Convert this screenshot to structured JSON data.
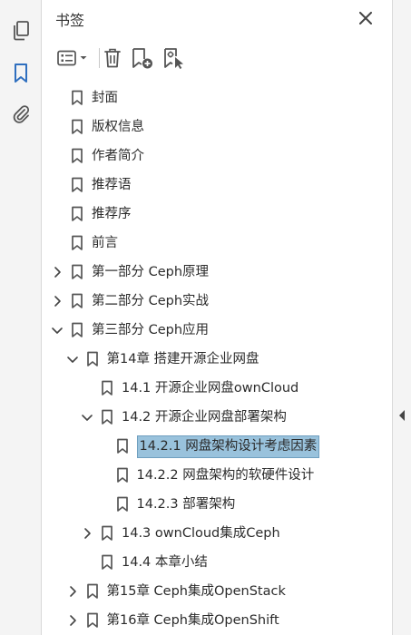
{
  "panel": {
    "title": "书签"
  },
  "left_rail": {
    "items": [
      "pages-icon",
      "bookmark-icon",
      "attachment-icon"
    ],
    "active": "bookmark-icon"
  },
  "toolbar": {
    "buttons": [
      "options-menu",
      "delete-bookmark",
      "new-bookmark",
      "new-bookmark-from-structure"
    ]
  },
  "tree": [
    {
      "label": "封面",
      "level": 0,
      "twisty": "none"
    },
    {
      "label": "版权信息",
      "level": 0,
      "twisty": "none"
    },
    {
      "label": "作者简介",
      "level": 0,
      "twisty": "none"
    },
    {
      "label": "推荐语",
      "level": 0,
      "twisty": "none"
    },
    {
      "label": "推荐序",
      "level": 0,
      "twisty": "none"
    },
    {
      "label": "前言",
      "level": 0,
      "twisty": "none"
    },
    {
      "label": "第一部分 Ceph原理",
      "level": 0,
      "twisty": "collapsed"
    },
    {
      "label": "第二部分 Ceph实战",
      "level": 0,
      "twisty": "collapsed"
    },
    {
      "label": "第三部分 Ceph应用",
      "level": 0,
      "twisty": "expanded"
    },
    {
      "label": "第14章 搭建开源企业网盘",
      "level": 1,
      "twisty": "expanded"
    },
    {
      "label": "14.1 开源企业网盘ownCloud",
      "level": 2,
      "twisty": "none"
    },
    {
      "label": "14.2 开源企业网盘部署架构",
      "level": 2,
      "twisty": "expanded"
    },
    {
      "label": "14.2.1 网盘架构设计考虑因素",
      "level": 3,
      "twisty": "none",
      "selected": true
    },
    {
      "label": "14.2.2 网盘架构的软硬件设计",
      "level": 3,
      "twisty": "none"
    },
    {
      "label": "14.2.3 部署架构",
      "level": 3,
      "twisty": "none"
    },
    {
      "label": "14.3 ownCloud集成Ceph",
      "level": 2,
      "twisty": "collapsed"
    },
    {
      "label": "14.4 本章小结",
      "level": 2,
      "twisty": "none"
    },
    {
      "label": "第15章 Ceph集成OpenStack",
      "level": 1,
      "twisty": "collapsed"
    },
    {
      "label": "第16章 Ceph集成OpenShift",
      "level": 1,
      "twisty": "collapsed"
    }
  ],
  "colors": {
    "accent": "#2f6fbf",
    "selection": "#99c2dc",
    "icon": "#555555"
  }
}
